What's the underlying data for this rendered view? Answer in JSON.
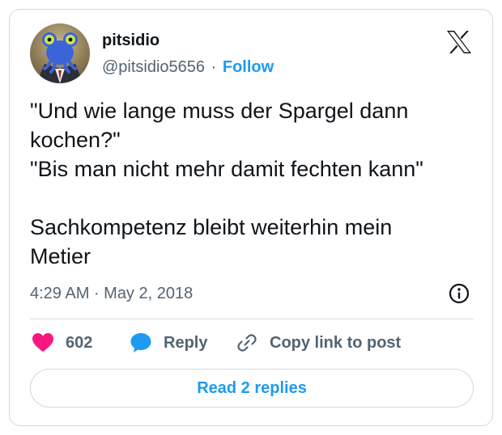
{
  "author": {
    "display_name": "pitsidio",
    "handle": "@pitsidio5656",
    "separator": "·",
    "follow_label": "Follow"
  },
  "tweet": {
    "text": "\"Und wie lange muss der Spargel dann\nkochen?\"\n\"Bis man nicht mehr damit fechten kann\"\n\nSachkompetenz bleibt weiterhin mein\nMetier",
    "timestamp": "4:29 AM · May 2, 2018"
  },
  "actions": {
    "like_count": "602",
    "reply_label": "Reply",
    "copy_label": "Copy link to post"
  },
  "read_replies_label": "Read 2 replies",
  "icons": {
    "logo": "x-logo-icon",
    "info": "info-icon",
    "like": "heart-icon",
    "reply": "speech-bubble-icon",
    "copy": "link-icon"
  },
  "colors": {
    "accent": "#1d9bf0",
    "like": "#f91880",
    "secondary_text": "#536471",
    "border": "#cfd9de"
  }
}
